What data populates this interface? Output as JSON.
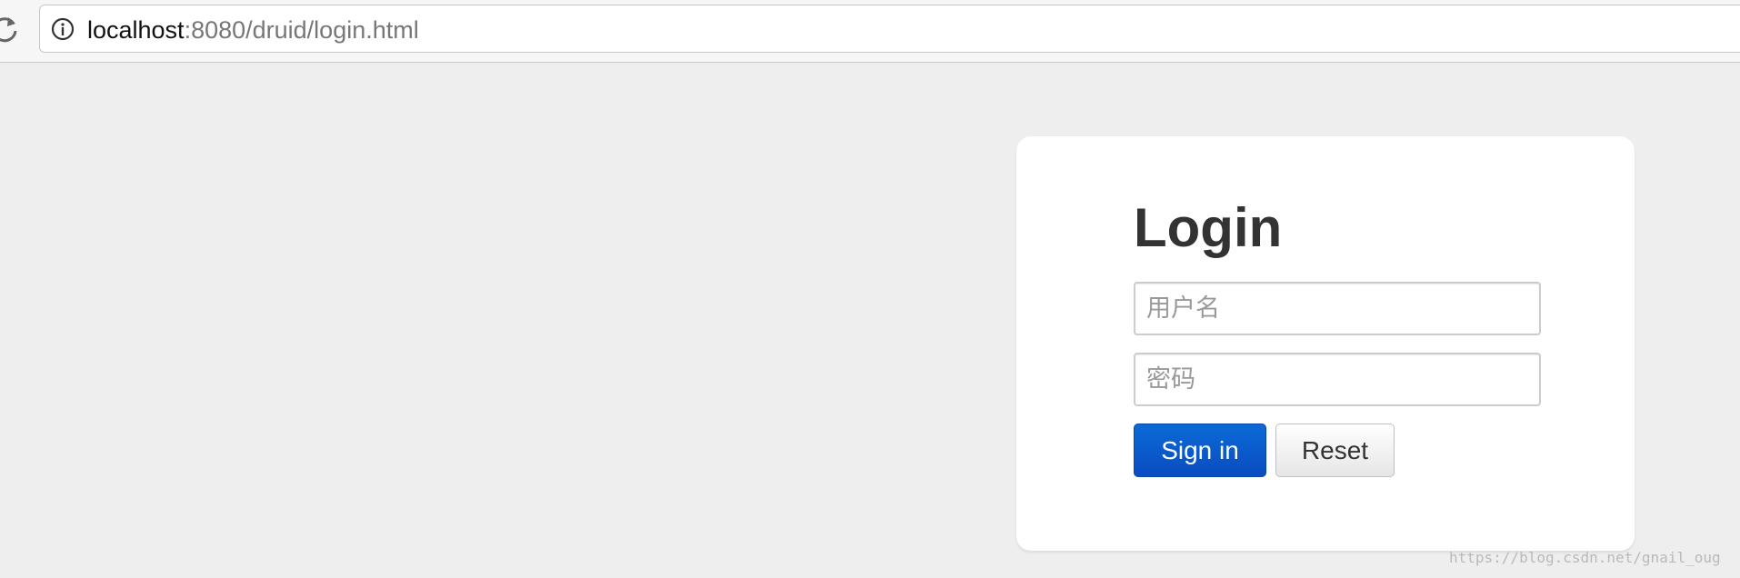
{
  "browser": {
    "url_host": "localhost",
    "url_rest": ":8080/druid/login.html",
    "icons": [
      "reload-icon",
      "info-icon"
    ]
  },
  "login": {
    "title": "Login",
    "username_placeholder": "用户名",
    "password_placeholder": "密码",
    "signin_label": "Sign in",
    "reset_label": "Reset"
  },
  "watermark": "https://blog.csdn.net/gnail_oug",
  "colors": {
    "page_background": "#eeeeee",
    "primary_button": "#0a4cc2",
    "title_text": "#333333"
  }
}
